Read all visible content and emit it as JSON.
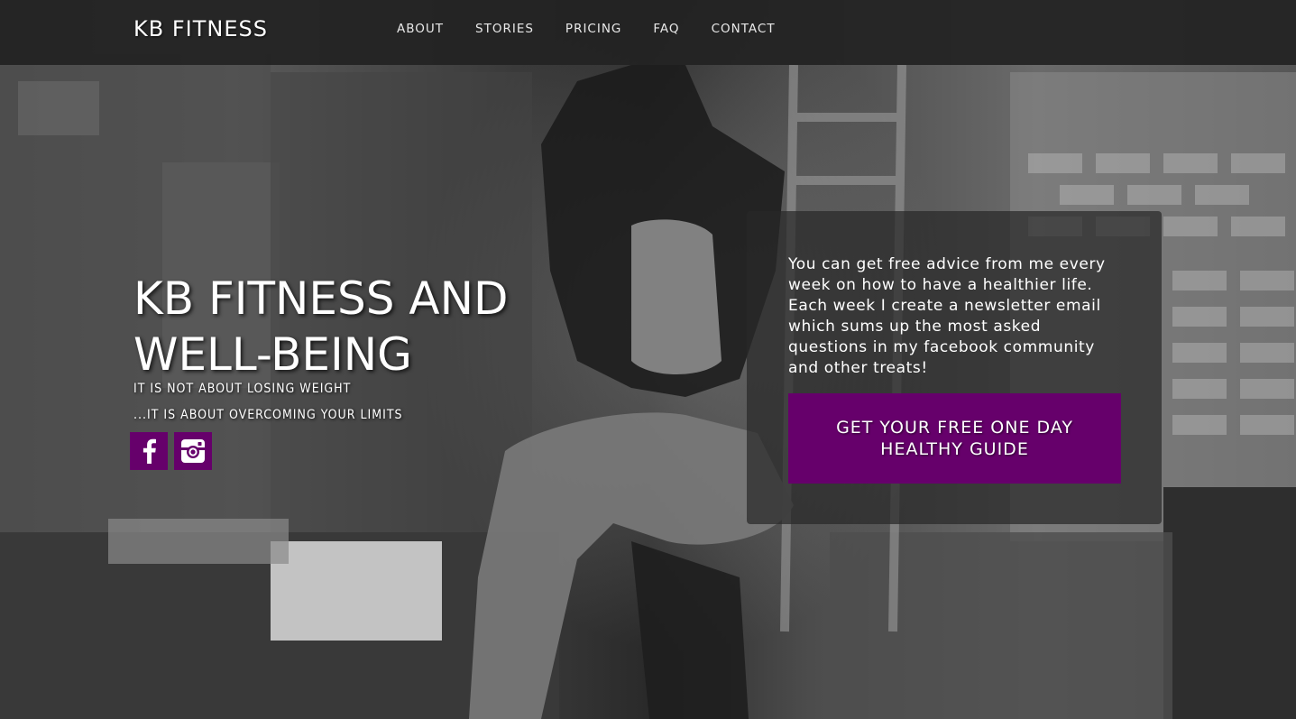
{
  "brand": "KB FITNESS",
  "nav": {
    "items": [
      "ABOUT",
      "STORIES",
      "PRICING",
      "FAQ",
      "CONTACT"
    ]
  },
  "hero": {
    "title": "KB FITNESS AND WELL-BEING",
    "tagline_1": "IT IS NOT ABOUT LOSING WEIGHT",
    "tagline_2": "...IT IS ABOUT OVERCOMING YOUR LIMITS",
    "social": [
      "facebook-icon",
      "instagram-icon"
    ]
  },
  "signup": {
    "text": "You can get free advice from me every week on how to have a healthier life. Each week I create a newsletter email which sums up the most asked questions in my facebook community and other treats!",
    "cta_label": "GET YOUR FREE ONE DAY HEALTHY GUIDE"
  },
  "colors": {
    "accent": "#66006b",
    "navbar": "#222222"
  }
}
